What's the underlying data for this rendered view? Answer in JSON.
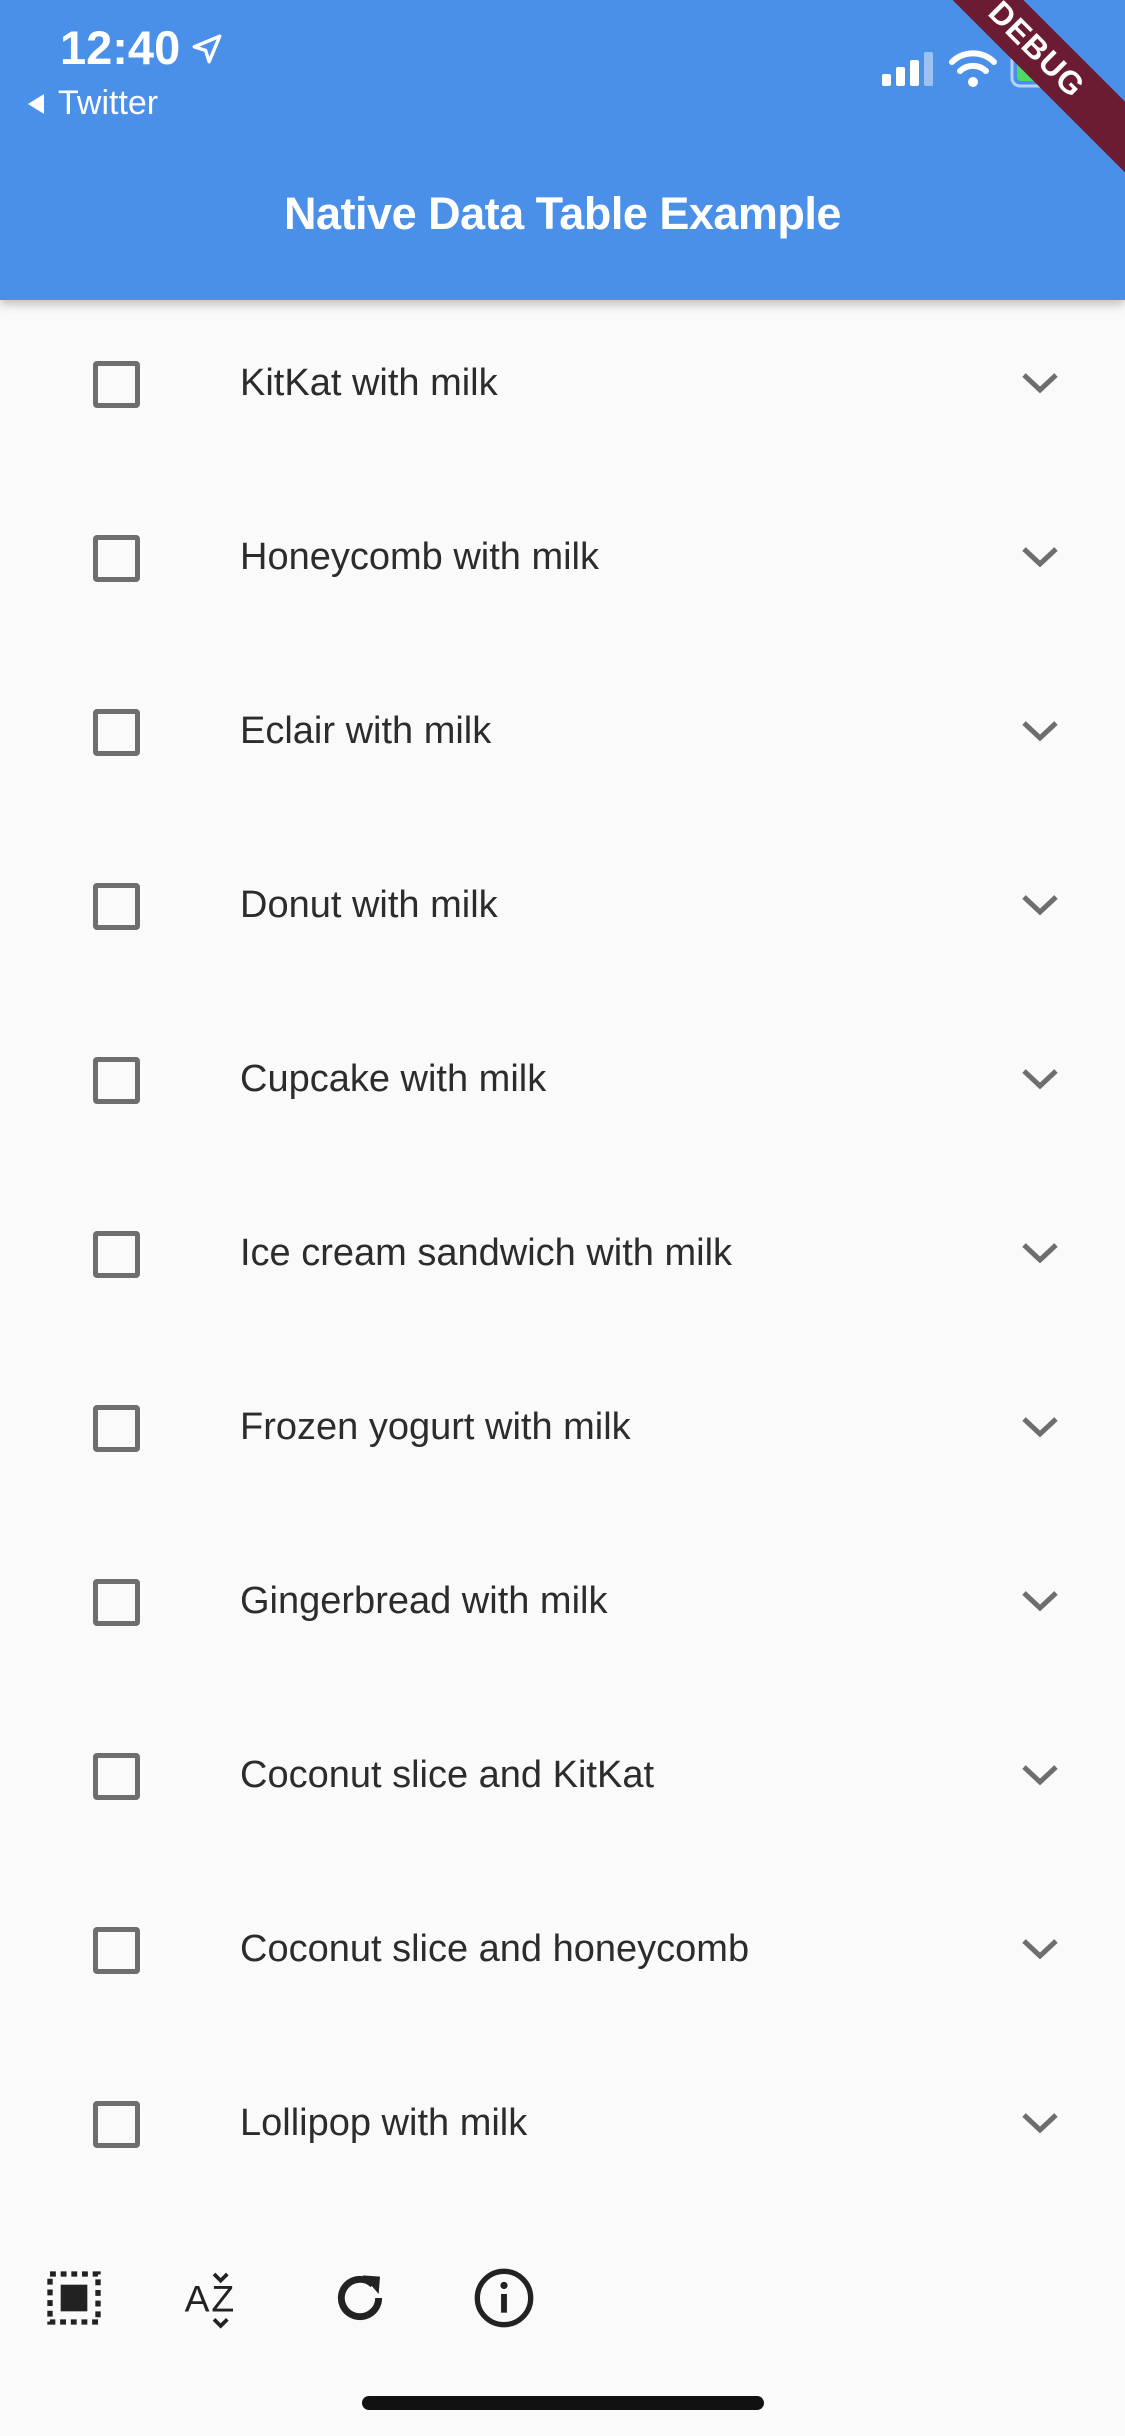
{
  "status_bar": {
    "time": "12:40",
    "back_app": "Twitter",
    "icons": [
      "location-arrow-icon",
      "signal-icon",
      "wifi-icon",
      "battery-icon"
    ]
  },
  "appbar": {
    "title": "Native Data Table Example",
    "background_color": "#4a90e8"
  },
  "debug_banner": "DEBUG",
  "rows": [
    {
      "label": "KitKat with milk",
      "checked": false
    },
    {
      "label": "Honeycomb with milk",
      "checked": false
    },
    {
      "label": "Eclair with milk",
      "checked": false
    },
    {
      "label": "Donut with milk",
      "checked": false
    },
    {
      "label": "Cupcake with milk",
      "checked": false
    },
    {
      "label": "Ice cream sandwich with milk",
      "checked": false
    },
    {
      "label": "Frozen yogurt with milk",
      "checked": false
    },
    {
      "label": "Gingerbread with milk",
      "checked": false
    },
    {
      "label": "Coconut slice and KitKat",
      "checked": false
    },
    {
      "label": "Coconut slice and honeycomb",
      "checked": false
    },
    {
      "label": "Lollipop with milk",
      "checked": false
    }
  ],
  "toolbar": {
    "icons": [
      "select-all-icon",
      "sort-az-icon",
      "refresh-icon",
      "info-icon"
    ]
  }
}
